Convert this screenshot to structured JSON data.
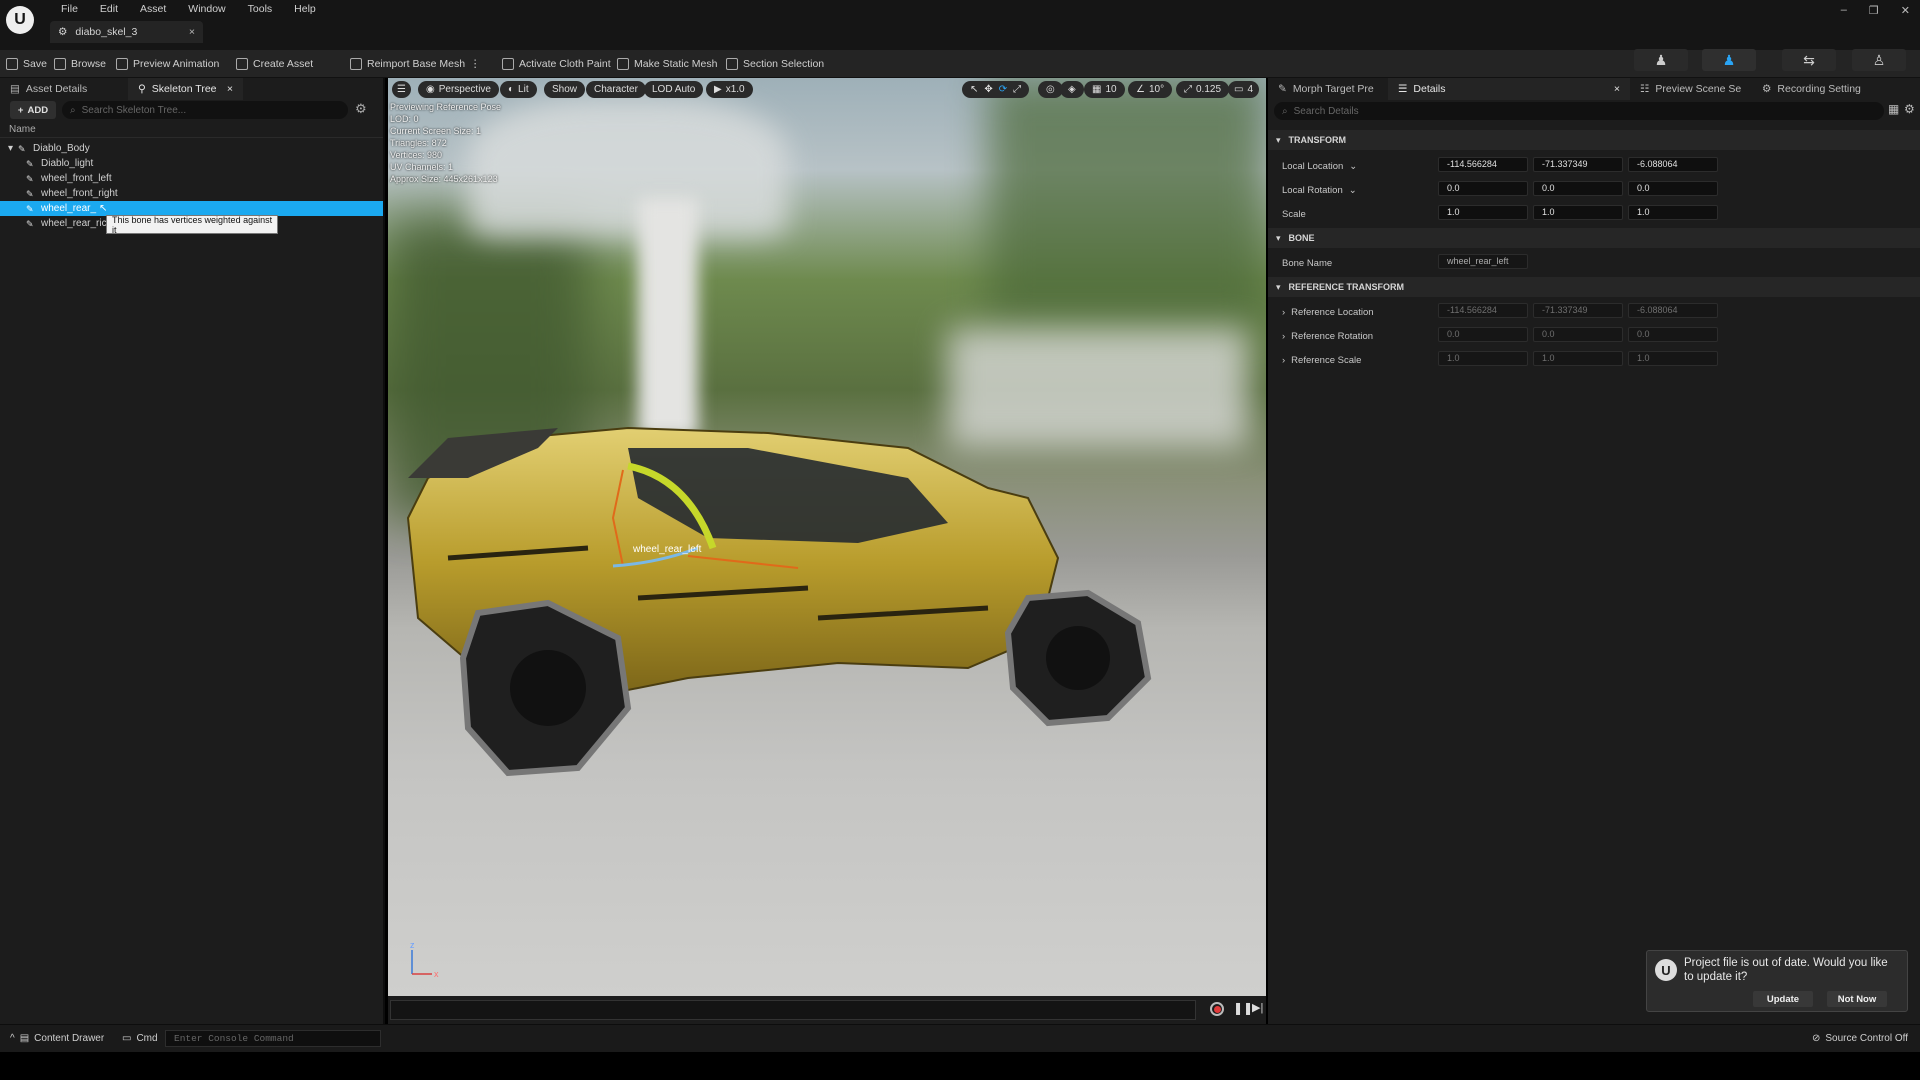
{
  "menu": [
    "File",
    "Edit",
    "Asset",
    "Window",
    "Tools",
    "Help"
  ],
  "document_tab": "diabo_skel_3",
  "toolbar": {
    "save": "Save",
    "browse": "Browse",
    "preview_animation": "Preview Animation",
    "create_asset": "Create Asset",
    "reimport_base_mesh": "Reimport Base Mesh",
    "activate_cloth_paint": "Activate Cloth Paint",
    "make_static_mesh": "Make Static Mesh",
    "section_selection": "Section Selection"
  },
  "left_panel": {
    "tabs": [
      "Asset Details",
      "Skeleton Tree"
    ],
    "add_label": "ADD",
    "search_placeholder": "Search Skeleton Tree...",
    "column_name": "Name",
    "bones": [
      "Diablo_Body",
      "Diablo_light",
      "wheel_front_left",
      "wheel_front_right",
      "wheel_rear_left",
      "wheel_rear_right"
    ],
    "bones_visible": [
      "Diablo_Body",
      "Diablo_light",
      "wheel_front_left",
      "wheel_front_right",
      "wheel_rear_",
      "wheel_rear_ric"
    ],
    "selected_index": 4,
    "tooltip": "This bone has vertices weighted against it"
  },
  "viewport": {
    "toolbar": {
      "perspective": "Perspective",
      "lit": "Lit",
      "show": "Show",
      "character": "Character",
      "lod": "LOD Auto",
      "play_rate": "x1.0",
      "grid_snap": "10",
      "rotation_snap": "10°",
      "scale_snap": "0.125",
      "camera_speed": "4"
    },
    "info": [
      "Previewing Reference Pose",
      "LOD: 0",
      "Current Screen Size: 1",
      "Triangles: 872",
      "Vertices: 980",
      "UV Channels: 1",
      "Approx Size: 445x261x123"
    ],
    "bone_label": "wheel_rear_left",
    "axis_z": "z",
    "axis_x": "x"
  },
  "right_panel": {
    "tabs": [
      "Morph Target Pre",
      "Details",
      "Preview Scene Se",
      "Recording Setting"
    ],
    "search_placeholder": "Search Details",
    "sections": {
      "transform": "TRANSFORM",
      "bone": "BONE",
      "reference_transform": "REFERENCE TRANSFORM"
    },
    "local_location": {
      "label": "Local Location",
      "x": "-114.566284",
      "y": "-71.337349",
      "z": "-6.088064"
    },
    "local_rotation": {
      "label": "Local Rotation",
      "x": "0.0",
      "y": "0.0",
      "z": "0.0"
    },
    "scale": {
      "label": "Scale",
      "x": "1.0",
      "y": "1.0",
      "z": "1.0"
    },
    "bone_name": {
      "label": "Bone Name",
      "value": "wheel_rear_left"
    },
    "reference_location": {
      "label": "Reference Location",
      "x": "-114.566284",
      "y": "-71.337349",
      "z": "-6.088064"
    },
    "reference_rotation": {
      "label": "Reference Rotation",
      "x": "0.0",
      "y": "0.0",
      "z": "0.0"
    },
    "reference_scale": {
      "label": "Reference Scale",
      "x": "1.0",
      "y": "1.0",
      "z": "1.0"
    }
  },
  "notification": {
    "text": "Project file is out of date. Would you like to update it?",
    "update": "Update",
    "not_now": "Not Now"
  },
  "statusbar": {
    "content_drawer": "Content Drawer",
    "cmd": "Cmd",
    "console_placeholder": "Enter Console Command",
    "source_control": "Source Control Off"
  },
  "colors": {
    "selection": "#1ba9f0",
    "panel": "#1c1c1c",
    "car_body": "#b89c2c",
    "bone_highlight": "#c6d82a"
  }
}
